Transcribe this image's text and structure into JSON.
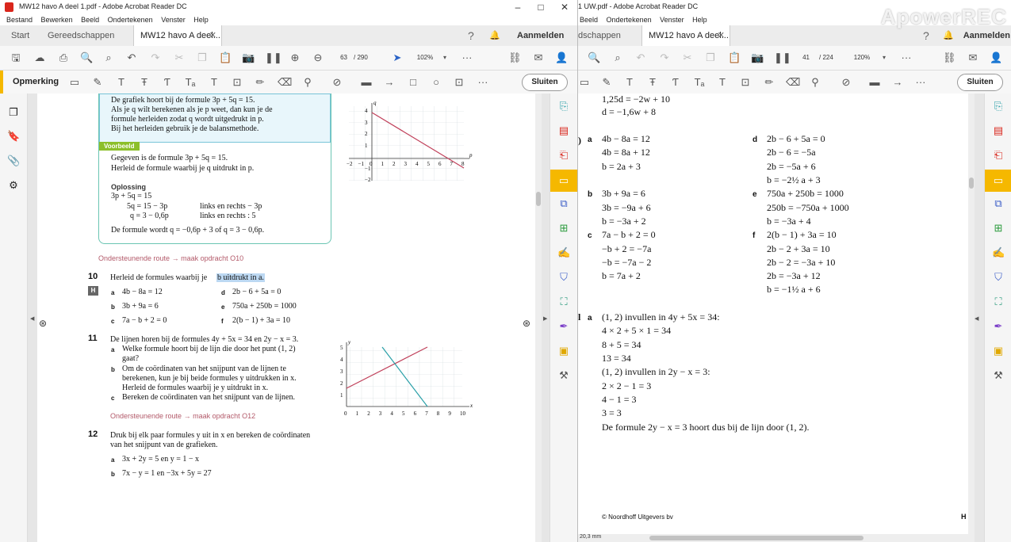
{
  "left": {
    "title": "MW12 havo A deel 1.pdf - Adobe Acrobat Reader DC",
    "menu": [
      "Bestand",
      "Bewerken",
      "Beeld",
      "Ondertekenen",
      "Venster",
      "Help"
    ],
    "tabs": {
      "start": "Start",
      "tools": "Gereedschappen",
      "doc": "MW12 havo A deel...",
      "signin": "Aanmelden"
    },
    "page_current": "63",
    "page_total": "/ 290",
    "zoom": "102%",
    "comment_label": "Opmerking",
    "close_label": "Sluiten"
  },
  "right": {
    "title": "1 UW.pdf - Adobe Acrobat Reader DC",
    "menu": [
      "Beeld",
      "Ondertekenen",
      "Venster",
      "Help"
    ],
    "tabs": {
      "tools": "dschappen",
      "doc": "MW12 havo A deel...",
      "signin": "Aanmelden"
    },
    "page_current": "41",
    "page_total": "/ 224",
    "zoom": "120%",
    "close_label": "Sluiten",
    "status_size": "20,3 mm"
  },
  "watermark": "ApowerREC",
  "textbook": {
    "info_lines": [
      "De grafiek hoort bij de formule 3p + 5q = 15.",
      "Als je q wilt berekenen als je p weet, dan kun je de",
      "formule herleiden zodat q wordt uitgedrukt in p.",
      "Bij het herleiden gebruik je de balansmethode."
    ],
    "info_blue1": "formule",
    "info_blue2": "herleiden",
    "info_blue3": "uitgedrukt in p",
    "voorbeeld": "Voorbeeld",
    "vb_lines": [
      "Gegeven is de formule 3p + 5q = 15.",
      "Herleid de formule waarbij je q uitdrukt in p."
    ],
    "oplossing": "Oplossing",
    "sol": [
      [
        "3p + 5q = 15",
        ""
      ],
      [
        "5q = 15 − 3p",
        "links en rechts − 3p"
      ],
      [
        "q = 3 − 0,6p",
        "links en rechts :  5"
      ]
    ],
    "conclusion": "De formule wordt q = −0,6p + 3 of q = 3 − 0,6p.",
    "route1": "Ondersteunende route → maak opdracht O10",
    "q10_num": "10",
    "q10_text": "Herleid de formules waarbij je",
    "q10_sel": "b uitdrukt in a.",
    "h_badge": "H",
    "q10_items": [
      [
        "a",
        "4b − 8a = 12"
      ],
      [
        "d",
        "2b − 6 + 5a = 0"
      ],
      [
        "b",
        "3b + 9a = 6"
      ],
      [
        "e",
        "750a + 250b = 1000"
      ],
      [
        "c",
        "7a − b + 2 = 0"
      ],
      [
        "f",
        "2(b − 1) + 3a = 10"
      ]
    ],
    "q11_num": "11",
    "q11_text": "De lijnen horen bij de formules 4y + 5x = 34 en 2y − x = 3.",
    "q11_a": [
      "Welke formule hoort bij de lijn die door het punt (1, 2)",
      "gaat?"
    ],
    "q11_b": [
      "Om de coördinaten van het snijpunt van de lijnen te",
      "berekenen, kun je bij beide formules y uitdrukken in x.",
      "Herleid de formules waarbij je y uitdrukt in x."
    ],
    "q11_c": "Bereken de coördinaten van het snijpunt van de lijnen.",
    "route2": "Ondersteunende route → maak opdracht O12",
    "q12_num": "12",
    "q12_text": [
      "Druk bij elk paar formules y uit in x en bereken de coördinaten",
      "van het snijpunt van de grafieken."
    ],
    "q12_items": [
      [
        "a",
        "3x + 2y = 5 en y = 1 − x"
      ],
      [
        "b",
        "7x − y = 1 en −3x + 5y = 27"
      ]
    ],
    "graph1": {
      "xlabel": "p",
      "ylabel": "q",
      "xticks": [
        "−2",
        "−1",
        "0",
        "1",
        "2",
        "3",
        "4",
        "5",
        "6",
        "7",
        "8"
      ],
      "yticks": [
        "4",
        "3",
        "2",
        "1",
        "−1",
        "−2"
      ]
    },
    "graph2": {
      "xlabel": "x",
      "ylabel": "y",
      "xticks": [
        "0",
        "1",
        "2",
        "3",
        "4",
        "5",
        "6",
        "7",
        "8",
        "9",
        "10"
      ],
      "yticks": [
        "5",
        "4",
        "3",
        "2",
        "1"
      ]
    }
  },
  "answers": {
    "top": [
      "1,25d = −2w + 10",
      "d = −1,6w + 8"
    ],
    "sec_a": "a",
    "a": [
      "4b − 8a = 12",
      "4b = 8a + 12",
      "b = 2a + 3"
    ],
    "sec_d": "d",
    "d": [
      "2b − 6 + 5a = 0",
      "2b − 6 = −5a",
      "2b = −5a + 6",
      "b = −2½ a + 3"
    ],
    "sec_b": "b",
    "b": [
      "3b + 9a = 6",
      "3b = −9a + 6",
      "b = −3a + 2"
    ],
    "sec_e": "e",
    "e": [
      "750a + 250b = 1000",
      "250b = −750a + 1000",
      "b = −3a + 4"
    ],
    "sec_c": "c",
    "c": [
      "7a − b + 2 = 0",
      "−b + 2 = −7a",
      "−b = −7a − 2",
      "b = 7a + 2"
    ],
    "sec_f": "f",
    "f": [
      "2(b − 1) + 3a = 10",
      "2b − 2 + 3a = 10",
      "2b − 2 = −3a + 10",
      "2b = −3a + 12",
      "b = −1½ a + 6"
    ],
    "q11_label": "a",
    "q11": [
      "(1, 2) invullen in 4y + 5x = 34:",
      "4 × 2 + 5 × 1 = 34",
      "8 + 5 = 34",
      "13 = 34",
      "(1, 2) invullen in 2y − x = 3:",
      "2 × 2 − 1 = 3",
      "4 − 1 = 3",
      "3 = 3",
      "De formule 2y − x = 3 hoort dus bij de lijn door (1, 2)."
    ],
    "footer": "© Noordhoff Uitgevers bv",
    "footer_h": "H"
  },
  "colors": {
    "accent": "#f5b800",
    "red_line": "#c0405a",
    "teal_line": "#2aa0a8",
    "blue_text": "#0b8fb8",
    "route": "#b35a6a"
  }
}
